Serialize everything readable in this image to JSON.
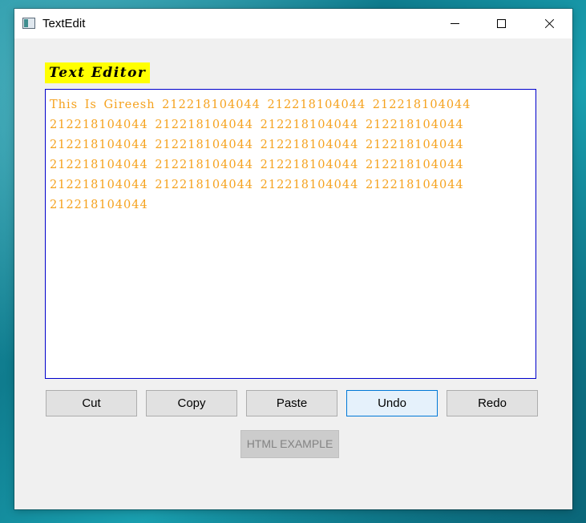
{
  "window": {
    "title": "TextEdit"
  },
  "titlebar": {
    "icon": "app-window-icon",
    "minimize_icon": "minimize-icon",
    "maximize_icon": "maximize-icon",
    "close_icon": "close-icon"
  },
  "editor": {
    "label": "Text Editor",
    "content": "This Is Gireesh 212218104044 212218104044 212218104044 212218104044 212218104044 212218104044 212218104044 212218104044 212218104044 212218104044 212218104044 212218104044 212218104044 212218104044 212218104044 212218104044 212218104044 212218104044 212218104044 212218104044",
    "text_color": "#f5a21e",
    "label_background": "#ffff00",
    "border_color": "#0000cc"
  },
  "buttons": {
    "cut": "Cut",
    "copy": "Copy",
    "paste": "Paste",
    "undo": "Undo",
    "redo": "Redo",
    "html_example": "HTML EXAMPLE"
  }
}
